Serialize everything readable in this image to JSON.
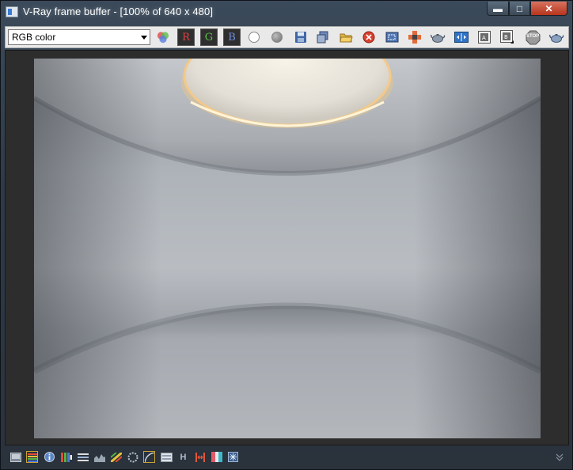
{
  "window": {
    "title": "V-Ray frame buffer - [100% of 640 x 480]",
    "controls": {
      "minimize": "▬",
      "maximize": "□",
      "close": "✕"
    }
  },
  "toolbar": {
    "channel_select": {
      "selected": "RGB color"
    },
    "channels": {
      "red": "R",
      "green": "G",
      "blue": "B"
    },
    "buttons": [
      "white-swatch-icon",
      "gray-swatch-icon",
      "save-icon",
      "duplicate-icon",
      "open-icon",
      "clear-icon",
      "region-icon",
      "track-mouse-icon",
      "render-teapot-icon",
      "compare-ab-icon",
      "history-a-icon",
      "history-b-icon",
      "stop-icon",
      "render-last-icon"
    ],
    "stop_label": "STOP"
  },
  "render": {
    "description_colors": {
      "wall": "#b6babf",
      "shadow": "#6e7379",
      "light": "#f7f3e8",
      "glow": "#f3c98a"
    }
  },
  "statusbar": {
    "h_label": "H",
    "icons": [
      "show-panel-icon",
      "color-correction-icon",
      "info-icon",
      "lut-icon",
      "levels-icon",
      "histogram-icon",
      "exposure-icon",
      "pixel-aspect-icon",
      "curve-icon",
      "srgb-icon",
      "hue-icon",
      "split-icon",
      "chromatic-icon",
      "collapse-icon"
    ]
  }
}
